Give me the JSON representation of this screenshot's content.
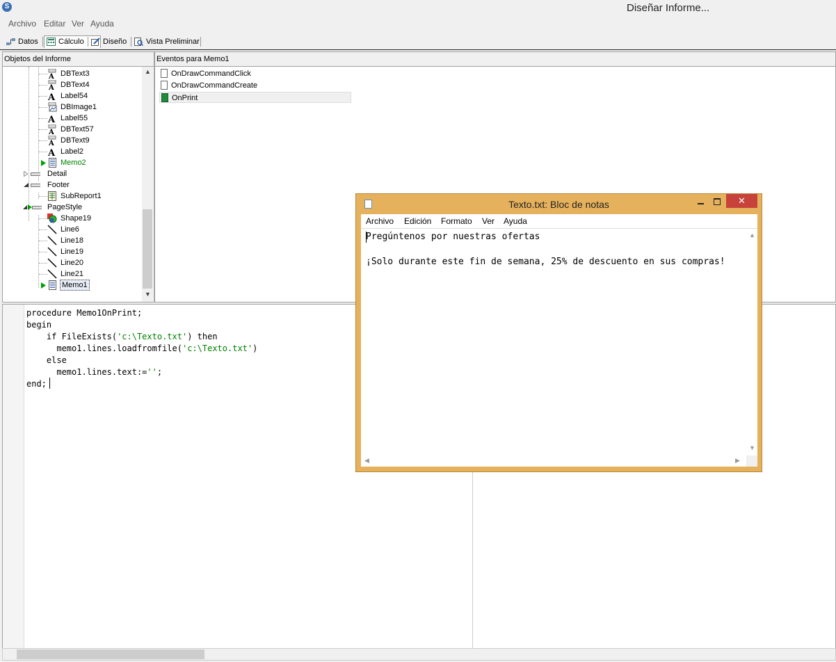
{
  "window": {
    "title": "Diseñar Informe...",
    "app_icon": "S"
  },
  "menu": [
    "Archivo",
    "Editar",
    "Ver",
    "Ayuda"
  ],
  "tabs": [
    {
      "label": "Datos",
      "icon": "data-icon",
      "active": false
    },
    {
      "label": "Cálculo",
      "icon": "calculator-icon",
      "active": true
    },
    {
      "label": "Diseño",
      "icon": "design-icon",
      "active": false
    },
    {
      "label": "Vista Preliminar",
      "icon": "preview-icon",
      "active": false
    }
  ],
  "objects_panel": {
    "title": "Objetos del Informe",
    "items": [
      {
        "label": "DBText3",
        "icon": "dbtext-icon",
        "level": 2
      },
      {
        "label": "DBText4",
        "icon": "dbtext-icon",
        "level": 2
      },
      {
        "label": "Label54",
        "icon": "label-icon",
        "level": 2
      },
      {
        "label": "DBImage1",
        "icon": "dbimage-icon",
        "level": 2
      },
      {
        "label": "Label55",
        "icon": "label-icon",
        "level": 2
      },
      {
        "label": "DBText57",
        "icon": "dbtext-icon",
        "level": 2
      },
      {
        "label": "DBText9",
        "icon": "dbtext-icon",
        "level": 2
      },
      {
        "label": "Label2",
        "icon": "label-icon",
        "level": 2
      },
      {
        "label": "Memo2",
        "icon": "memo-icon",
        "level": 2,
        "has_event": true
      },
      {
        "label": "Detail",
        "icon": "band-icon",
        "level": 1,
        "expander": "collapsed"
      },
      {
        "label": "Footer",
        "icon": "band-icon",
        "level": 1,
        "expander": "expanded"
      },
      {
        "label": "SubReport1",
        "icon": "subreport-icon",
        "level": 2
      },
      {
        "label": "PageStyle",
        "icon": "band-icon",
        "level": 1,
        "expander": "expanded",
        "has_event": true
      },
      {
        "label": "Shape19",
        "icon": "shape-icon",
        "level": 2
      },
      {
        "label": "Line6",
        "icon": "line-icon",
        "level": 2
      },
      {
        "label": "Line18",
        "icon": "line-icon",
        "level": 2
      },
      {
        "label": "Line19",
        "icon": "line-icon",
        "level": 2
      },
      {
        "label": "Line20",
        "icon": "line-icon",
        "level": 2
      },
      {
        "label": "Line21",
        "icon": "line-icon",
        "level": 2
      },
      {
        "label": "Memo1",
        "icon": "memo-icon",
        "level": 2,
        "has_event": true,
        "selected": true
      }
    ]
  },
  "events_panel": {
    "title": "Eventos para Memo1",
    "events": [
      {
        "label": "OnDrawCommandClick",
        "has_code": false
      },
      {
        "label": "OnDrawCommandCreate",
        "has_code": false
      },
      {
        "label": "OnPrint",
        "has_code": true,
        "selected": true
      }
    ]
  },
  "code": [
    {
      "indent": "",
      "parts": [
        {
          "t": "procedure Memo1OnPrint;",
          "s": false
        }
      ]
    },
    {
      "indent": "",
      "parts": [
        {
          "t": "begin",
          "s": false
        }
      ]
    },
    {
      "indent": "    ",
      "parts": [
        {
          "t": "if FileExists(",
          "s": false
        },
        {
          "t": "'c:\\Texto.txt'",
          "s": true
        },
        {
          "t": ") then",
          "s": false
        }
      ]
    },
    {
      "indent": "      ",
      "parts": [
        {
          "t": "memo1.lines.loadfromfile(",
          "s": false
        },
        {
          "t": "'c:\\Texto.txt'",
          "s": true
        },
        {
          "t": ")",
          "s": false
        }
      ]
    },
    {
      "indent": "    ",
      "parts": [
        {
          "t": "else",
          "s": false
        }
      ]
    },
    {
      "indent": "      ",
      "parts": [
        {
          "t": "memo1.lines.text:=",
          "s": false
        },
        {
          "t": "''",
          "s": true
        },
        {
          "t": ";",
          "s": false
        }
      ]
    },
    {
      "indent": "",
      "parts": [
        {
          "t": "end;",
          "s": false
        }
      ]
    }
  ],
  "notepad": {
    "title": "Texto.txt: Bloc de notas",
    "close_glyph": "✕",
    "menu": [
      "Archivo",
      "Edición",
      "Formato",
      "Ver",
      "Ayuda"
    ],
    "lines": [
      "Pregúntenos por nuestras ofertas",
      "",
      "¡Solo durante este fin de semana, 25% de descuento en sus compras!"
    ]
  },
  "colors": {
    "selected_event": "#f0f0f0",
    "string_literal": "#008000",
    "notepad_frame": "#e6b15c",
    "close_button": "#c7423a",
    "event_label_memo": "#008000"
  }
}
